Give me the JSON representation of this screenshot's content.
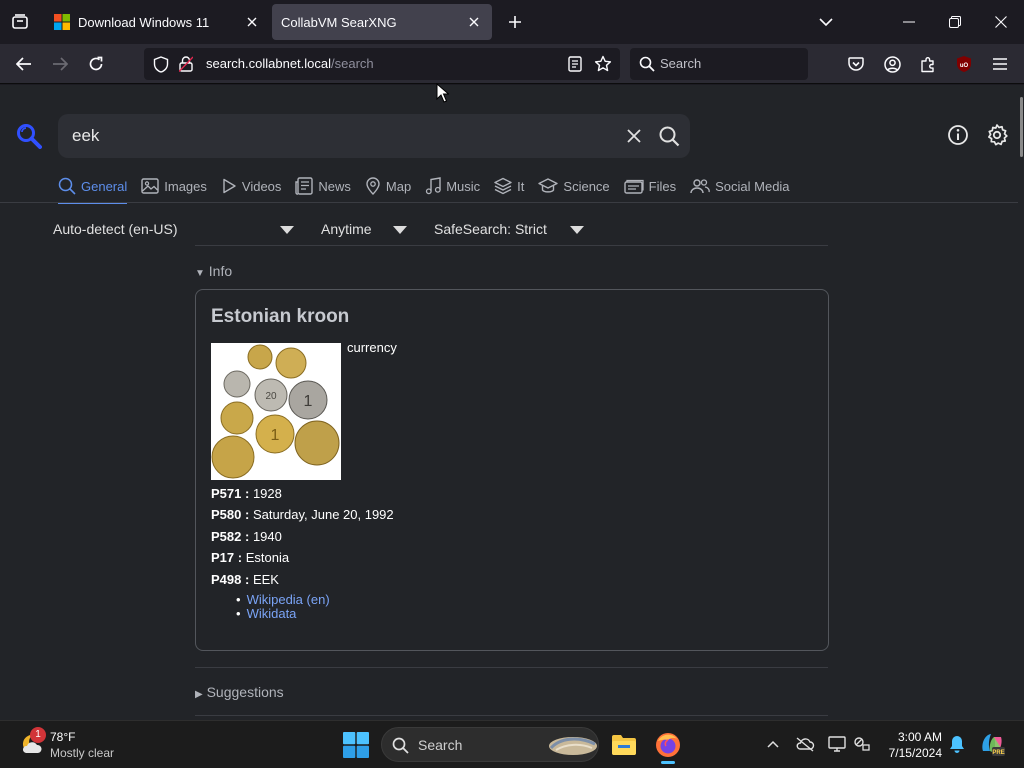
{
  "browser": {
    "tabs": [
      {
        "title": "Download Windows 11",
        "active": false
      },
      {
        "title": "CollabVM SearXNG",
        "active": true
      }
    ],
    "url": {
      "host": "search.collabnet.local",
      "path": "/search"
    },
    "search_placeholder": "Search"
  },
  "searx": {
    "query": "eek",
    "categories": [
      {
        "label": "General",
        "icon": "search-icon",
        "active": true
      },
      {
        "label": "Images",
        "icon": "image-icon",
        "active": false
      },
      {
        "label": "Videos",
        "icon": "play-icon",
        "active": false
      },
      {
        "label": "News",
        "icon": "newspaper-icon",
        "active": false
      },
      {
        "label": "Map",
        "icon": "map-pin-icon",
        "active": false
      },
      {
        "label": "Music",
        "icon": "music-note-icon",
        "active": false
      },
      {
        "label": "It",
        "icon": "layers-icon",
        "active": false
      },
      {
        "label": "Science",
        "icon": "graduation-cap-icon",
        "active": false
      },
      {
        "label": "Files",
        "icon": "files-icon",
        "active": false
      },
      {
        "label": "Social Media",
        "icon": "people-icon",
        "active": false
      }
    ],
    "filters": {
      "language": "Auto-detect (en-US)",
      "time": "Anytime",
      "safesearch": "SafeSearch: Strict"
    },
    "info_toggle": "Info",
    "suggestions_toggle": "Suggestions",
    "infobox": {
      "title": "Estonian kroon",
      "description": "currency",
      "attributes": [
        {
          "label": "P571 :",
          "value": "1928"
        },
        {
          "label": "P580 :",
          "value": "Saturday, June 20, 1992"
        },
        {
          "label": "P582 :",
          "value": "1940"
        },
        {
          "label": "P17 :",
          "value": "Estonia"
        },
        {
          "label": "P498 :",
          "value": "EEK"
        }
      ],
      "links": [
        "Wikipedia (en)",
        "Wikidata"
      ]
    }
  },
  "taskbar": {
    "weather": {
      "temp": "78°F",
      "condition": "Mostly clear",
      "badge": "1"
    },
    "search_label": "Search",
    "time": "3:00 AM",
    "date": "7/15/2024"
  },
  "colors": {
    "accent": "#5d8eeb",
    "link": "#7aa3f5",
    "page_bg": "#222428",
    "chrome_bg": "#1c1b22"
  }
}
